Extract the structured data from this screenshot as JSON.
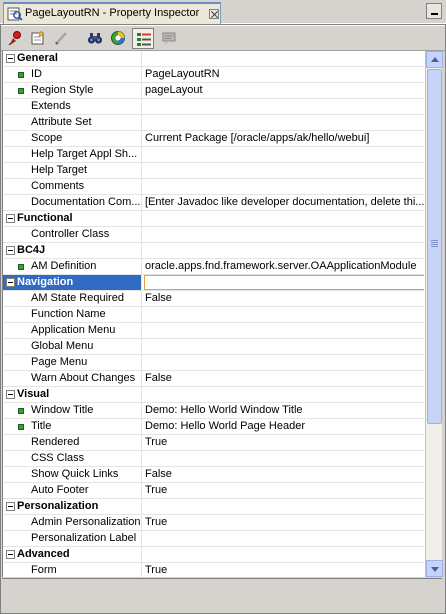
{
  "window": {
    "tab_title": "PageLayoutRN - Property Inspector",
    "icons": {
      "tab": "property-inspector-icon",
      "close": "close-icon",
      "minimize": "minimize-icon"
    }
  },
  "toolbar": {
    "buttons": [
      {
        "name": "pin-icon",
        "tooltip": ""
      },
      {
        "name": "new-property-icon",
        "tooltip": ""
      },
      {
        "name": "edit-pencil-icon",
        "tooltip": ""
      },
      {
        "name": "find-binoculars-icon",
        "tooltip": ""
      },
      {
        "name": "color-filter-icon",
        "tooltip": ""
      },
      {
        "name": "categorized-view-icon",
        "tooltip": ""
      },
      {
        "name": "description-toggle-icon",
        "tooltip": ""
      }
    ]
  },
  "colors": {
    "selection": "#316ac5",
    "edit_border": "#e8a040",
    "bullet": "#3c9a3c"
  },
  "rows": [
    {
      "type": "category",
      "name": "General",
      "value": ""
    },
    {
      "type": "prop",
      "name": "ID",
      "value": "PageLayoutRN",
      "required": true
    },
    {
      "type": "prop",
      "name": "Region Style",
      "value": "pageLayout",
      "required": true
    },
    {
      "type": "prop",
      "name": "Extends",
      "value": ""
    },
    {
      "type": "prop",
      "name": "Attribute Set",
      "value": ""
    },
    {
      "type": "prop",
      "name": "Scope",
      "value": "Current Package [/oracle/apps/ak/hello/webui]"
    },
    {
      "type": "prop",
      "name": "Help Target Appl Sh...",
      "value": ""
    },
    {
      "type": "prop",
      "name": "Help Target",
      "value": ""
    },
    {
      "type": "prop",
      "name": "Comments",
      "value": ""
    },
    {
      "type": "prop",
      "name": "Documentation Com...",
      "value": "[Enter Javadoc like developer documentation, delete thi..."
    },
    {
      "type": "category",
      "name": "Functional",
      "value": ""
    },
    {
      "type": "prop",
      "name": "Controller Class",
      "value": ""
    },
    {
      "type": "category",
      "name": "BC4J",
      "value": ""
    },
    {
      "type": "prop",
      "name": "AM Definition",
      "value": "oracle.apps.fnd.framework.server.OAApplicationModule",
      "required": true
    },
    {
      "type": "category",
      "name": "Navigation",
      "value": "",
      "selected": true
    },
    {
      "type": "prop",
      "name": "AM State Required",
      "value": "False"
    },
    {
      "type": "prop",
      "name": "Function Name",
      "value": ""
    },
    {
      "type": "prop",
      "name": "Application Menu",
      "value": ""
    },
    {
      "type": "prop",
      "name": "Global Menu",
      "value": ""
    },
    {
      "type": "prop",
      "name": "Page Menu",
      "value": ""
    },
    {
      "type": "prop",
      "name": "Warn About Changes",
      "value": "False"
    },
    {
      "type": "category",
      "name": "Visual",
      "value": ""
    },
    {
      "type": "prop",
      "name": "Window Title",
      "value": "Demo: Hello World Window Title",
      "required": true
    },
    {
      "type": "prop",
      "name": "Title",
      "value": "Demo: Hello World Page Header",
      "required": true
    },
    {
      "type": "prop",
      "name": "Rendered",
      "value": "True"
    },
    {
      "type": "prop",
      "name": "CSS Class",
      "value": ""
    },
    {
      "type": "prop",
      "name": "Show Quick Links",
      "value": "False"
    },
    {
      "type": "prop",
      "name": "Auto Footer",
      "value": "True"
    },
    {
      "type": "category",
      "name": "Personalization",
      "value": ""
    },
    {
      "type": "prop",
      "name": "Admin Personalization",
      "value": "True"
    },
    {
      "type": "prop",
      "name": "Personalization Label",
      "value": ""
    },
    {
      "type": "category",
      "name": "Advanced",
      "value": ""
    },
    {
      "type": "prop",
      "name": "Form",
      "value": "True"
    }
  ]
}
